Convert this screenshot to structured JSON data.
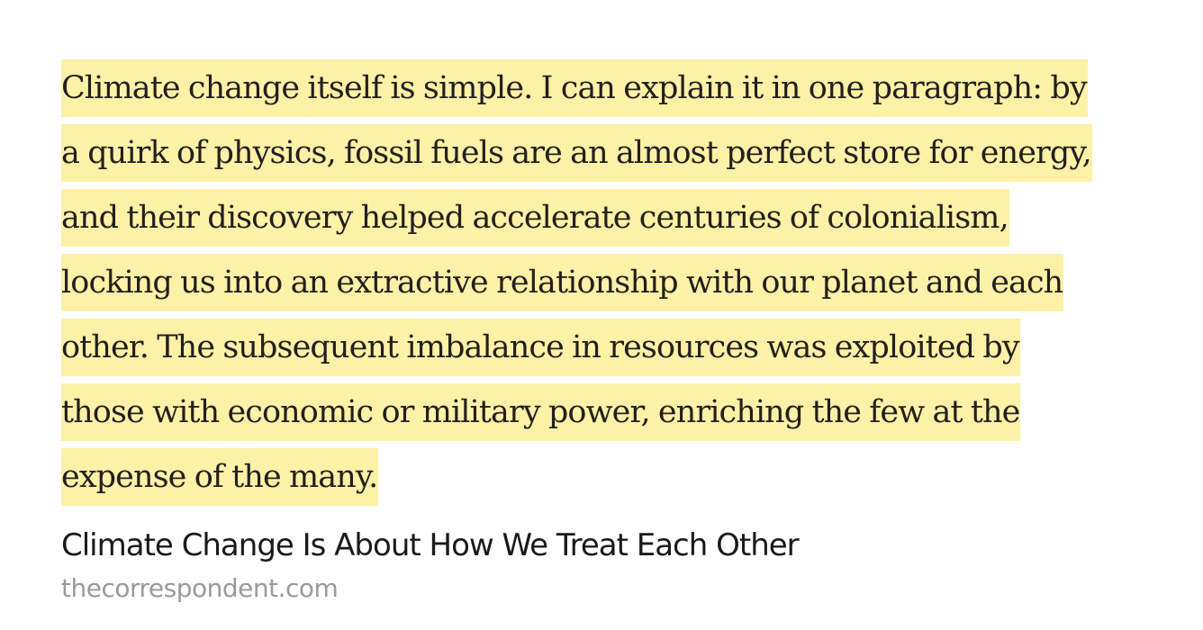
{
  "highlight": {
    "color": "#fdf1a8",
    "lines": [
      "Climate change itself is simple. I can explain it in one paragraph: by",
      "a quirk of physics, fossil fuels are an almost perfect store for energy,",
      "and their discovery helped accelerate centuries of colonialism,",
      "locking us into an extractive relationship with our planet and each",
      "other. The subsequent imbalance in resources was exploited by",
      "those with economic or military power, enriching the few at the",
      "expense of the many."
    ]
  },
  "source": {
    "title": "Climate Change Is About How We Treat Each Other",
    "domain": "thecorrespondent.com"
  }
}
